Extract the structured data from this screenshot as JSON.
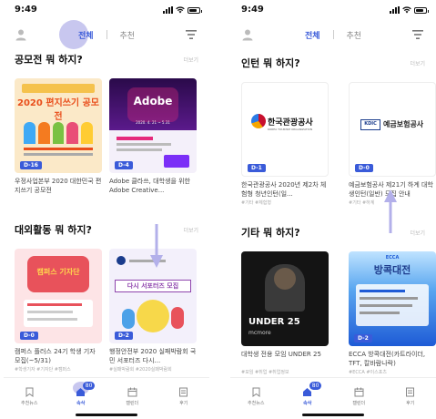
{
  "screens": [
    {
      "status_time": "9:49",
      "tabs": [
        "전체",
        "추천"
      ],
      "active_tab": 0,
      "sections": [
        {
          "title": "공모전 뭐 하지?",
          "more": "더보기",
          "cards": [
            {
              "dday": "D-16",
              "title": "우정사업본부 2020 대한민국 편지쓰기 공모전",
              "tags": "",
              "poster_text": "2020 편지쓰기 공모전",
              "poster_sub": "",
              "accent": "#f47b20"
            },
            {
              "dday": "D-4",
              "title": "Adobe 클라쓰, 대학생을 위한 Adobe Creative...",
              "tags": "",
              "poster_text": "Adobe",
              "poster_sub": "2020. 4. 21 ~ 5.31",
              "accent": "#7b2ff7"
            }
          ]
        },
        {
          "title": "대외활동 뭐 하지?",
          "more": "더보기",
          "cards": [
            {
              "dday": "D-0",
              "title": "캠퍼스 플러스 24기 학생 기자 모집(~5/31)",
              "tags": "#학생기자 #기자단 #캠퍼스",
              "poster_text": "캠퍼스 기자단",
              "poster_sub": "",
              "accent": "#e8525b"
            },
            {
              "dday": "D-2",
              "title": "행정안전부 2020 실패박람회 국민 서포터즈 다시...",
              "tags": "#실패박람회 #2020실패박람회",
              "poster_text": "다시 서포터즈 모집",
              "poster_sub": "",
              "accent": "#8e44ad"
            }
          ]
        }
      ],
      "nav": [
        {
          "label": "추천뉴스",
          "icon": "bookmark-icon"
        },
        {
          "label": "속삭",
          "icon": "home-icon",
          "badge": "80"
        },
        {
          "label": "캘린더",
          "icon": "calendar-icon"
        },
        {
          "label": "후기",
          "icon": "review-icon"
        }
      ],
      "active_nav": 1
    },
    {
      "status_time": "9:49",
      "tabs": [
        "전체",
        "추천"
      ],
      "active_tab": 0,
      "sections": [
        {
          "title": "인턴 뭐 하지?",
          "more": "더보기",
          "cards": [
            {
              "dday": "D-1",
              "title": "한국관광공사 2020년 제2차 체험형 청년인턴(일...",
              "tags": "#기타 #체험형",
              "poster_text": "한국관광공사",
              "poster_sub": "KOREA TOURISM ORGANIZATION",
              "accent": "#c8102e"
            },
            {
              "dday": "D-0",
              "title": "예금보험공사 제21기 하계 대학생인턴(일반) 모집 안내",
              "tags": "#기타 #하계",
              "poster_text": "예금보험공사",
              "poster_sub": "KDIC",
              "accent": "#1a3c8c"
            }
          ]
        },
        {
          "title": "기타 뭐 하지?",
          "more": "더보기",
          "cards": [
            {
              "dday": "",
              "title": "대학생 전용 모임 UNDER 25",
              "tags": "#모임 #취업 #취업정보",
              "poster_text": "UNDER 25",
              "poster_sub": "mcmore",
              "accent": "#1a1a1a"
            },
            {
              "dday": "D-2",
              "title": "ECCA 방콕대전(카트라이더, TFT, 칼바람나락)",
              "tags": "#ECCA #이스포츠",
              "poster_text": "방콕대전",
              "poster_sub": "ECCA",
              "accent": "#1e5bd6"
            }
          ]
        }
      ],
      "nav": [
        {
          "label": "추천뉴스",
          "icon": "bookmark-icon"
        },
        {
          "label": "속삭",
          "icon": "home-icon",
          "badge": "80"
        },
        {
          "label": "캘린더",
          "icon": "calendar-icon"
        },
        {
          "label": "후기",
          "icon": "review-icon"
        }
      ],
      "active_nav": 1
    }
  ]
}
